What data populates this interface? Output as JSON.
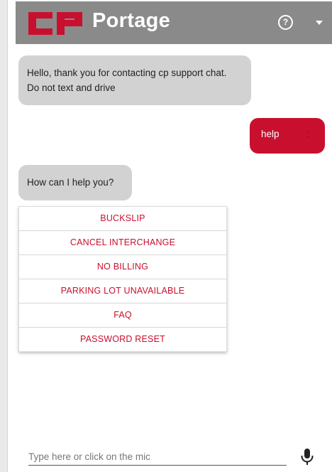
{
  "header": {
    "logo_text": "CP",
    "title": "Portage",
    "help_icon": "question-circle-icon",
    "menu_icon": "caret-down-icon",
    "brand_color": "#c8102e",
    "header_color": "#8a8a8a"
  },
  "chat": {
    "messages": [
      {
        "sender": "bot",
        "lines": [
          "Hello, thank you for contacting cp support chat.",
          "Do not text and drive"
        ]
      },
      {
        "sender": "user",
        "text": "help",
        "extra": ":"
      },
      {
        "sender": "bot",
        "text": "How can I help you?"
      }
    ],
    "options": [
      "BUCKSLIP",
      "CANCEL INTERCHANGE",
      "NO BILLING",
      "PARKING LOT UNAVAILABLE",
      "FAQ",
      "PASSWORD RESET"
    ]
  },
  "input": {
    "placeholder": "Type here or click on the mic",
    "mic_icon": "microphone-icon"
  }
}
